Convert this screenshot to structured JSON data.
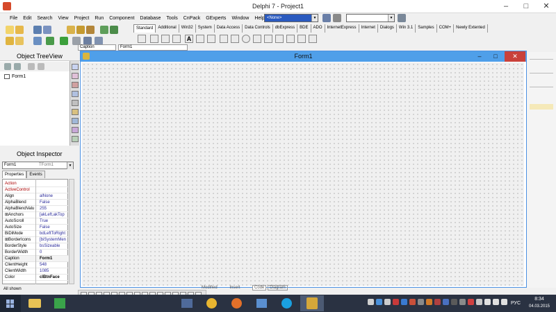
{
  "window": {
    "title": "Delphi 7 - Project1",
    "minimize": "–",
    "maximize": "□",
    "close": "✕"
  },
  "menu": [
    "File",
    "Edit",
    "Search",
    "View",
    "Project",
    "Run",
    "Component",
    "Database",
    "Tools",
    "CnPack",
    "GExperts",
    "Window",
    "Help"
  ],
  "toolbar": {
    "combo_value": "<None>",
    "combo2_value": ""
  },
  "palette_tabs": [
    "Standard",
    "Additional",
    "Win32",
    "System",
    "Data Access",
    "Data Controls",
    "dbExpress",
    "BDE",
    "ADO",
    "InternetExpress",
    "Internet",
    "Dialogs",
    "Win 3.1",
    "Samples",
    "COM+",
    "Newly Extented"
  ],
  "palette_active": "Standard",
  "tree_view": {
    "title": "Object TreeView",
    "items": [
      "Form1"
    ]
  },
  "inspector": {
    "title": "Object Inspector",
    "object": "Form1",
    "object_type": "TForm1",
    "tabs": [
      "Properties",
      "Events"
    ],
    "props": [
      {
        "n": "Action",
        "v": ""
      },
      {
        "n": "ActiveControl",
        "v": ""
      },
      {
        "n": "Align",
        "v": "alNone"
      },
      {
        "n": "AlphaBlend",
        "v": "False"
      },
      {
        "n": "AlphaBlendValu",
        "v": "255"
      },
      {
        "n": "⊞Anchors",
        "v": "[akLeft,akTop"
      },
      {
        "n": "AutoScroll",
        "v": "True"
      },
      {
        "n": "AutoSize",
        "v": "False"
      },
      {
        "n": "BiDiMode",
        "v": "bdLeftToRight"
      },
      {
        "n": "⊞BorderIcons",
        "v": "[biSystemMen"
      },
      {
        "n": "BorderStyle",
        "v": "bsSizeable"
      },
      {
        "n": "BorderWidth",
        "v": "0"
      },
      {
        "n": "Caption",
        "v": "Form1"
      },
      {
        "n": "ClientHeight",
        "v": "548"
      },
      {
        "n": "ClientWidth",
        "v": "1085"
      },
      {
        "n": "Color",
        "v": "clBtnFace"
      }
    ],
    "status": "All shown",
    "caption_field": "Caption",
    "caption_value": "Form1"
  },
  "form": {
    "title": "Form1"
  },
  "editor_status": {
    "modified": "Modified",
    "insert": "Insert",
    "code": "Code",
    "diagram": "Diagram"
  },
  "taskbar": {
    "lang": "РУС",
    "time": "8:34",
    "date": "04.03.2015"
  }
}
